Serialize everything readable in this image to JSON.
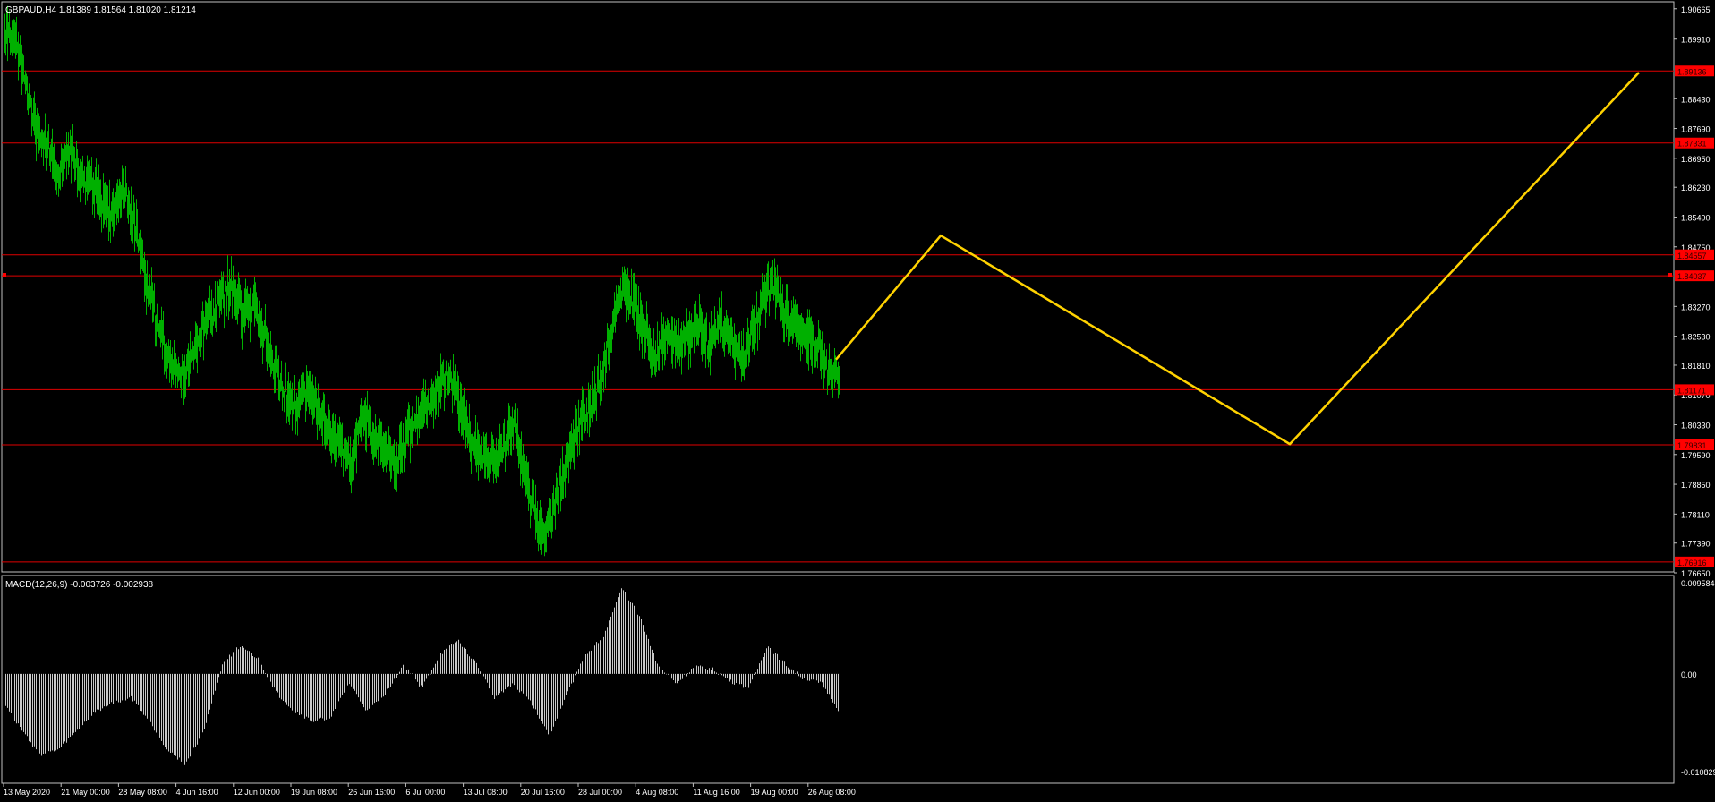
{
  "main_chart": {
    "header": "GBPAUD,H4  1.81389 1.81564 1.81020 1.81214",
    "symbol": "GBPAUD",
    "timeframe": "H4",
    "ohlc": [
      1.81389,
      1.81564,
      1.8102,
      1.81214
    ],
    "price_ticks": [
      "1.90665",
      "1.89910",
      "1.88430",
      "1.87690",
      "1.86950",
      "1.86230",
      "1.85490",
      "1.84750",
      "1.83270",
      "1.82530",
      "1.81810",
      "1.81070",
      "1.80330",
      "1.79590",
      "1.78850",
      "1.78110",
      "1.77390",
      "1.76650"
    ],
    "horizontal_levels": [
      {
        "price": 1.8912,
        "label": "1.89136"
      },
      {
        "price": 1.8733,
        "label": "1.87331"
      },
      {
        "price": 1.8455,
        "label": "1.84557"
      },
      {
        "price": 1.8403,
        "label": "1.84037"
      },
      {
        "price": 1.812,
        "label": "1.81171"
      },
      {
        "price": 1.7983,
        "label": "1.79831"
      },
      {
        "price": 1.7692,
        "label": "1.76916"
      }
    ],
    "x_labels": [
      "13 May 2020",
      "21 May 00:00",
      "28 May 08:00",
      "4 Jun 16:00",
      "12 Jun 00:00",
      "19 Jun 08:00",
      "26 Jun 16:00",
      "6 Jul 00:00",
      "13 Jul 08:00",
      "20 Jul 16:00",
      "28 Jul 00:00",
      "4 Aug 08:00",
      "11 Aug 16:00",
      "19 Aug 00:00",
      "26 Aug 08:00"
    ],
    "forecast_path": [
      {
        "bar": 0,
        "price": 1.8195
      },
      {
        "bar": 6,
        "price": 1.8503
      },
      {
        "bar": 26,
        "price": 1.7985
      },
      {
        "bar": 46,
        "price": 1.8908
      }
    ]
  },
  "macd_panel": {
    "header": "MACD(12,26,9) -0.003726 -0.002938",
    "ticks": [
      "0.009584",
      "0.00",
      "-0.010829"
    ]
  },
  "colors": {
    "background": "#000000",
    "frame": "#c0c0c0",
    "candle": "#00b000",
    "level_line": "#e00000",
    "level_label_bg": "#ff0000",
    "forecast": "#ffd200",
    "macd_bar": "#c8c8c8",
    "text": "#ffffff"
  },
  "chart_data": [
    {
      "type": "line",
      "title": "GBPAUD,H4",
      "x_type": "datetime",
      "y_range": [
        1.7665,
        1.9066
      ],
      "grid": false,
      "legend": "none",
      "anchors": [
        [
          "2020-05-13",
          1.9
        ],
        [
          "2020-05-14",
          1.899
        ],
        [
          "2020-05-15",
          1.888
        ],
        [
          "2020-05-18",
          1.876
        ],
        [
          "2020-05-19",
          1.873
        ],
        [
          "2020-05-20",
          1.864
        ],
        [
          "2020-05-21",
          1.872
        ],
        [
          "2020-05-22",
          1.865
        ],
        [
          "2020-05-25",
          1.863
        ],
        [
          "2020-05-26",
          1.859
        ],
        [
          "2020-05-27",
          1.856
        ],
        [
          "2020-05-28",
          1.862
        ],
        [
          "2020-05-29",
          1.854
        ],
        [
          "2020-06-01",
          1.84
        ],
        [
          "2020-06-02",
          1.83
        ],
        [
          "2020-06-03",
          1.82
        ],
        [
          "2020-06-04",
          1.815
        ],
        [
          "2020-06-05",
          1.818
        ],
        [
          "2020-06-08",
          1.825
        ],
        [
          "2020-06-09",
          1.83
        ],
        [
          "2020-06-10",
          1.835
        ],
        [
          "2020-06-11",
          1.838
        ],
        [
          "2020-06-12",
          1.83
        ],
        [
          "2020-06-15",
          1.833
        ],
        [
          "2020-06-16",
          1.825
        ],
        [
          "2020-06-17",
          1.817
        ],
        [
          "2020-06-18",
          1.81
        ],
        [
          "2020-06-19",
          1.808
        ],
        [
          "2020-06-22",
          1.812
        ],
        [
          "2020-06-23",
          1.806
        ],
        [
          "2020-06-24",
          1.802
        ],
        [
          "2020-06-25",
          1.797
        ],
        [
          "2020-06-26",
          1.794
        ],
        [
          "2020-06-29",
          1.806
        ],
        [
          "2020-06-30",
          1.8
        ],
        [
          "2020-07-01",
          1.797
        ],
        [
          "2020-07-02",
          1.794
        ],
        [
          "2020-07-03",
          1.8
        ],
        [
          "2020-07-06",
          1.805
        ],
        [
          "2020-07-07",
          1.808
        ],
        [
          "2020-07-08",
          1.813
        ],
        [
          "2020-07-09",
          1.816
        ],
        [
          "2020-07-10",
          1.809
        ],
        [
          "2020-07-13",
          1.8
        ],
        [
          "2020-07-14",
          1.796
        ],
        [
          "2020-07-15",
          1.794
        ],
        [
          "2020-07-16",
          1.797
        ],
        [
          "2020-07-17",
          1.804
        ],
        [
          "2020-07-20",
          1.79
        ],
        [
          "2020-07-21",
          1.78
        ],
        [
          "2020-07-22",
          1.776
        ],
        [
          "2020-07-23",
          1.787
        ],
        [
          "2020-07-24",
          1.796
        ],
        [
          "2020-07-27",
          1.804
        ],
        [
          "2020-07-28",
          1.807
        ],
        [
          "2020-07-29",
          1.815
        ],
        [
          "2020-07-30",
          1.828
        ],
        [
          "2020-07-31",
          1.837
        ],
        [
          "2020-08-03",
          1.833
        ],
        [
          "2020-08-04",
          1.827
        ],
        [
          "2020-08-05",
          1.82
        ],
        [
          "2020-08-06",
          1.826
        ],
        [
          "2020-08-07",
          1.823
        ],
        [
          "2020-08-10",
          1.825
        ],
        [
          "2020-08-11",
          1.828
        ],
        [
          "2020-08-12",
          1.822
        ],
        [
          "2020-08-13",
          1.829
        ],
        [
          "2020-08-14",
          1.824
        ],
        [
          "2020-08-17",
          1.82
        ],
        [
          "2020-08-18",
          1.826
        ],
        [
          "2020-08-19",
          1.834
        ],
        [
          "2020-08-20",
          1.838
        ],
        [
          "2020-08-21",
          1.83
        ],
        [
          "2020-08-24",
          1.829
        ],
        [
          "2020-08-25",
          1.825
        ],
        [
          "2020-08-26",
          1.823
        ],
        [
          "2020-08-27",
          1.817
        ],
        [
          "2020-08-28",
          1.815
        ]
      ]
    },
    {
      "type": "bar",
      "title": "MACD(12,26,9)",
      "y_range": [
        -0.010829,
        0.009584
      ],
      "grid": false,
      "legend": "none",
      "anchors": [
        [
          "2020-05-13",
          -0.003
        ],
        [
          "2020-05-15",
          -0.006
        ],
        [
          "2020-05-18",
          -0.0085
        ],
        [
          "2020-05-20",
          -0.008
        ],
        [
          "2020-05-22",
          -0.006
        ],
        [
          "2020-05-25",
          -0.004
        ],
        [
          "2020-05-27",
          -0.003
        ],
        [
          "2020-05-29",
          -0.0025
        ],
        [
          "2020-06-01",
          -0.005
        ],
        [
          "2020-06-03",
          -0.008
        ],
        [
          "2020-06-05",
          -0.0095
        ],
        [
          "2020-06-08",
          -0.006
        ],
        [
          "2020-06-10",
          0.001
        ],
        [
          "2020-06-12",
          0.003
        ],
        [
          "2020-06-15",
          0.0015
        ],
        [
          "2020-06-17",
          -0.002
        ],
        [
          "2020-06-19",
          -0.004
        ],
        [
          "2020-06-22",
          -0.005
        ],
        [
          "2020-06-24",
          -0.0045
        ],
        [
          "2020-06-26",
          -0.001
        ],
        [
          "2020-06-29",
          -0.004
        ],
        [
          "2020-07-01",
          -0.002
        ],
        [
          "2020-07-03",
          0.001
        ],
        [
          "2020-07-06",
          -0.0015
        ],
        [
          "2020-07-08",
          0.002
        ],
        [
          "2020-07-10",
          0.0035
        ],
        [
          "2020-07-13",
          0.001
        ],
        [
          "2020-07-15",
          -0.0025
        ],
        [
          "2020-07-17",
          -0.001
        ],
        [
          "2020-07-20",
          -0.003
        ],
        [
          "2020-07-22",
          -0.0065
        ],
        [
          "2020-07-24",
          -0.002
        ],
        [
          "2020-07-27",
          0.002
        ],
        [
          "2020-07-29",
          0.004
        ],
        [
          "2020-07-31",
          0.009
        ],
        [
          "2020-08-03",
          0.006
        ],
        [
          "2020-08-05",
          0.0008
        ],
        [
          "2020-08-07",
          -0.001
        ],
        [
          "2020-08-10",
          0.0008
        ],
        [
          "2020-08-12",
          0.0005
        ],
        [
          "2020-08-14",
          -0.0008
        ],
        [
          "2020-08-17",
          -0.0015
        ],
        [
          "2020-08-19",
          0.003
        ],
        [
          "2020-08-21",
          0.001
        ],
        [
          "2020-08-24",
          -0.0005
        ],
        [
          "2020-08-26",
          -0.001
        ],
        [
          "2020-08-28",
          -0.004
        ]
      ]
    }
  ]
}
